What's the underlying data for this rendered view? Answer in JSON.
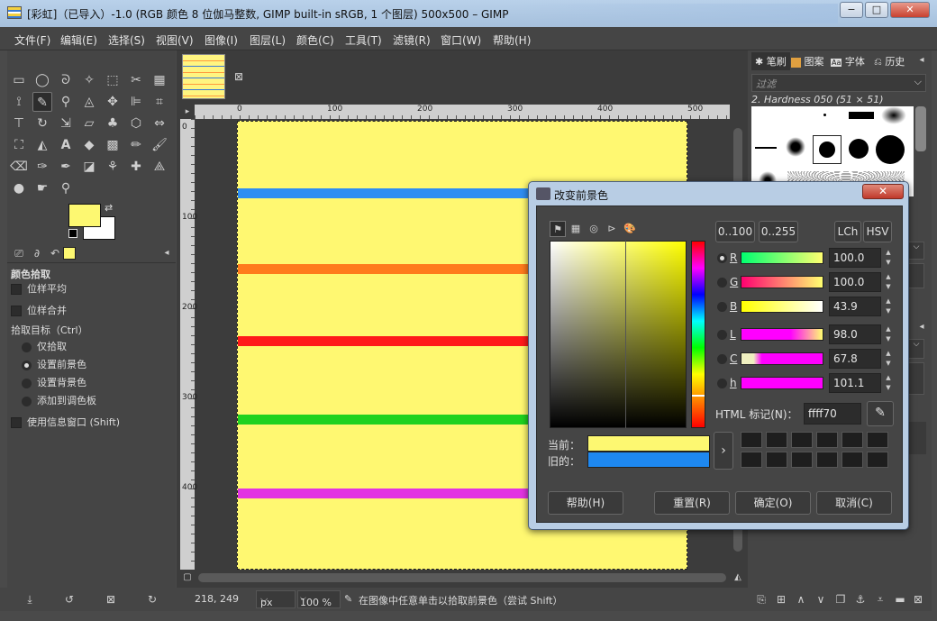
{
  "window": {
    "title": "[彩虹]（已导入）-1.0 (RGB 颜色 8 位伽马整数, GIMP built-in sRGB, 1 个图层) 500x500 – GIMP",
    "minimize": "−",
    "maximize": "□",
    "close": "✕"
  },
  "menu": [
    "文件(F)",
    "编辑(E)",
    "选择(S)",
    "视图(V)",
    "图像(I)",
    "图层(L)",
    "颜色(C)",
    "工具(T)",
    "滤镜(R)",
    "窗口(W)",
    "帮助(H)"
  ],
  "colors": {
    "foreground": "#fdf871",
    "background": "#ffffff",
    "accent": "#3a7bd5"
  },
  "tool_options": {
    "title": "颜色拾取",
    "sample_average": "位样平均",
    "sample_merged": "位样合并",
    "pick_target_label": "拾取目标（Ctrl）",
    "targets": [
      "仅拾取",
      "设置前景色",
      "设置背景色",
      "添加到调色板"
    ],
    "selected_target": "设置前景色",
    "use_info_window": "使用信息窗口 (Shift)"
  },
  "rulers": {
    "horizontal": [
      "0",
      "100",
      "200",
      "300",
      "400",
      "500"
    ],
    "vertical": [
      "0",
      "100",
      "200",
      "300",
      "400"
    ]
  },
  "image_stripes": [
    {
      "color": "#2f8ef2",
      "name": "blue"
    },
    {
      "color": "#ff7b1c",
      "name": "orange"
    },
    {
      "color": "#ff1a1a",
      "name": "red"
    },
    {
      "color": "#1fd21f",
      "name": "green"
    },
    {
      "color": "#e234e2",
      "name": "magenta"
    }
  ],
  "status": {
    "coords": "218, 249",
    "unit": "px",
    "zoom": "100 %",
    "message": "在图像中任意单击以拾取前景色（尝试 Shift）"
  },
  "right_panel": {
    "tabs": [
      "笔刷",
      "图案",
      "字体",
      "历史"
    ],
    "filter_placeholder": "过滤",
    "brush_name": "2. Hardness 050 (51 × 51)"
  },
  "dialog": {
    "title": "改变前景色",
    "close": "✕",
    "range_buttons": [
      "0..100",
      "0..255"
    ],
    "mode_buttons": [
      "LCh",
      "HSV"
    ],
    "channels": [
      {
        "label": "R",
        "value": "100.0",
        "selected": true
      },
      {
        "label": "G",
        "value": "100.0",
        "selected": false
      },
      {
        "label": "B",
        "value": "43.9",
        "selected": false
      },
      {
        "label": "L",
        "value": "98.0",
        "selected": false
      },
      {
        "label": "C",
        "value": "67.8",
        "selected": false
      },
      {
        "label": "h",
        "value": "101.1",
        "selected": false
      }
    ],
    "html_label": "HTML 标记(N)：",
    "html_value": "ffff70",
    "current_label": "当前：",
    "old_label": "旧的：",
    "current_color": "#fdf871",
    "old_color": "#1e88f0",
    "buttons": {
      "help": "帮助(H)",
      "reset": "重置(R)",
      "ok": "确定(O)",
      "cancel": "取消(C)"
    }
  }
}
